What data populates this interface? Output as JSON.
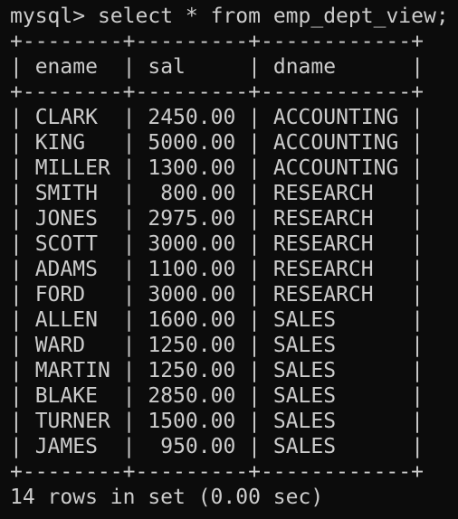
{
  "terminal": {
    "prompt": "mysql>",
    "command": "select * from emp_dept_view;",
    "border_line": "+--------+---------+------------+",
    "columns": [
      "ename",
      "sal",
      "dname"
    ],
    "col_widths": [
      6,
      7,
      10
    ],
    "rows": [
      [
        "CLARK",
        "2450.00",
        "ACCOUNTING"
      ],
      [
        "KING",
        "5000.00",
        "ACCOUNTING"
      ],
      [
        "MILLER",
        "1300.00",
        "ACCOUNTING"
      ],
      [
        "SMITH",
        "800.00",
        "RESEARCH"
      ],
      [
        "JONES",
        "2975.00",
        "RESEARCH"
      ],
      [
        "SCOTT",
        "3000.00",
        "RESEARCH"
      ],
      [
        "ADAMS",
        "1100.00",
        "RESEARCH"
      ],
      [
        "FORD",
        "3000.00",
        "RESEARCH"
      ],
      [
        "ALLEN",
        "1600.00",
        "SALES"
      ],
      [
        "WARD",
        "1250.00",
        "SALES"
      ],
      [
        "MARTIN",
        "1250.00",
        "SALES"
      ],
      [
        "BLAKE",
        "2850.00",
        "SALES"
      ],
      [
        "TURNER",
        "1500.00",
        "SALES"
      ],
      [
        "JAMES",
        "950.00",
        "SALES"
      ]
    ],
    "result_summary": "14 rows in set (0.00 sec)",
    "colors": {
      "background": "#0c0c0c",
      "foreground": "#cccccc"
    }
  }
}
